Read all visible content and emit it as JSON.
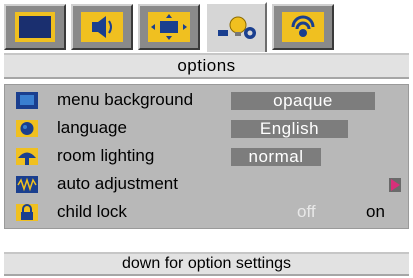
{
  "tabs": [
    {
      "icon": "picture-icon",
      "active": false
    },
    {
      "icon": "sound-icon",
      "active": false
    },
    {
      "icon": "screen-icon",
      "active": false
    },
    {
      "icon": "options-icon",
      "active": true
    },
    {
      "icon": "channels-icon",
      "active": false
    }
  ],
  "title": "options",
  "menu": {
    "items": [
      {
        "icon": "display-icon",
        "label": "menu background",
        "value": "opaque"
      },
      {
        "icon": "globe-icon",
        "label": "language",
        "value": "English"
      },
      {
        "icon": "lamp-icon",
        "label": "room lighting",
        "value": "normal"
      },
      {
        "icon": "waveform-icon",
        "label": "auto adjustment",
        "control": "arrow-right-icon"
      },
      {
        "icon": "lock-icon",
        "label": "child lock",
        "options": [
          "off",
          "on"
        ],
        "selected": "on"
      }
    ]
  },
  "hint": "down for option settings",
  "colors": {
    "panel": "#b8b8b8",
    "bar": "#e2e2e2",
    "tab": "#8a8a8a",
    "icon_yellow": "#f0c020",
    "icon_blue": "#1a3f8f",
    "value_box": "#7d7d7d",
    "arrow_pink": "#d8307a"
  }
}
